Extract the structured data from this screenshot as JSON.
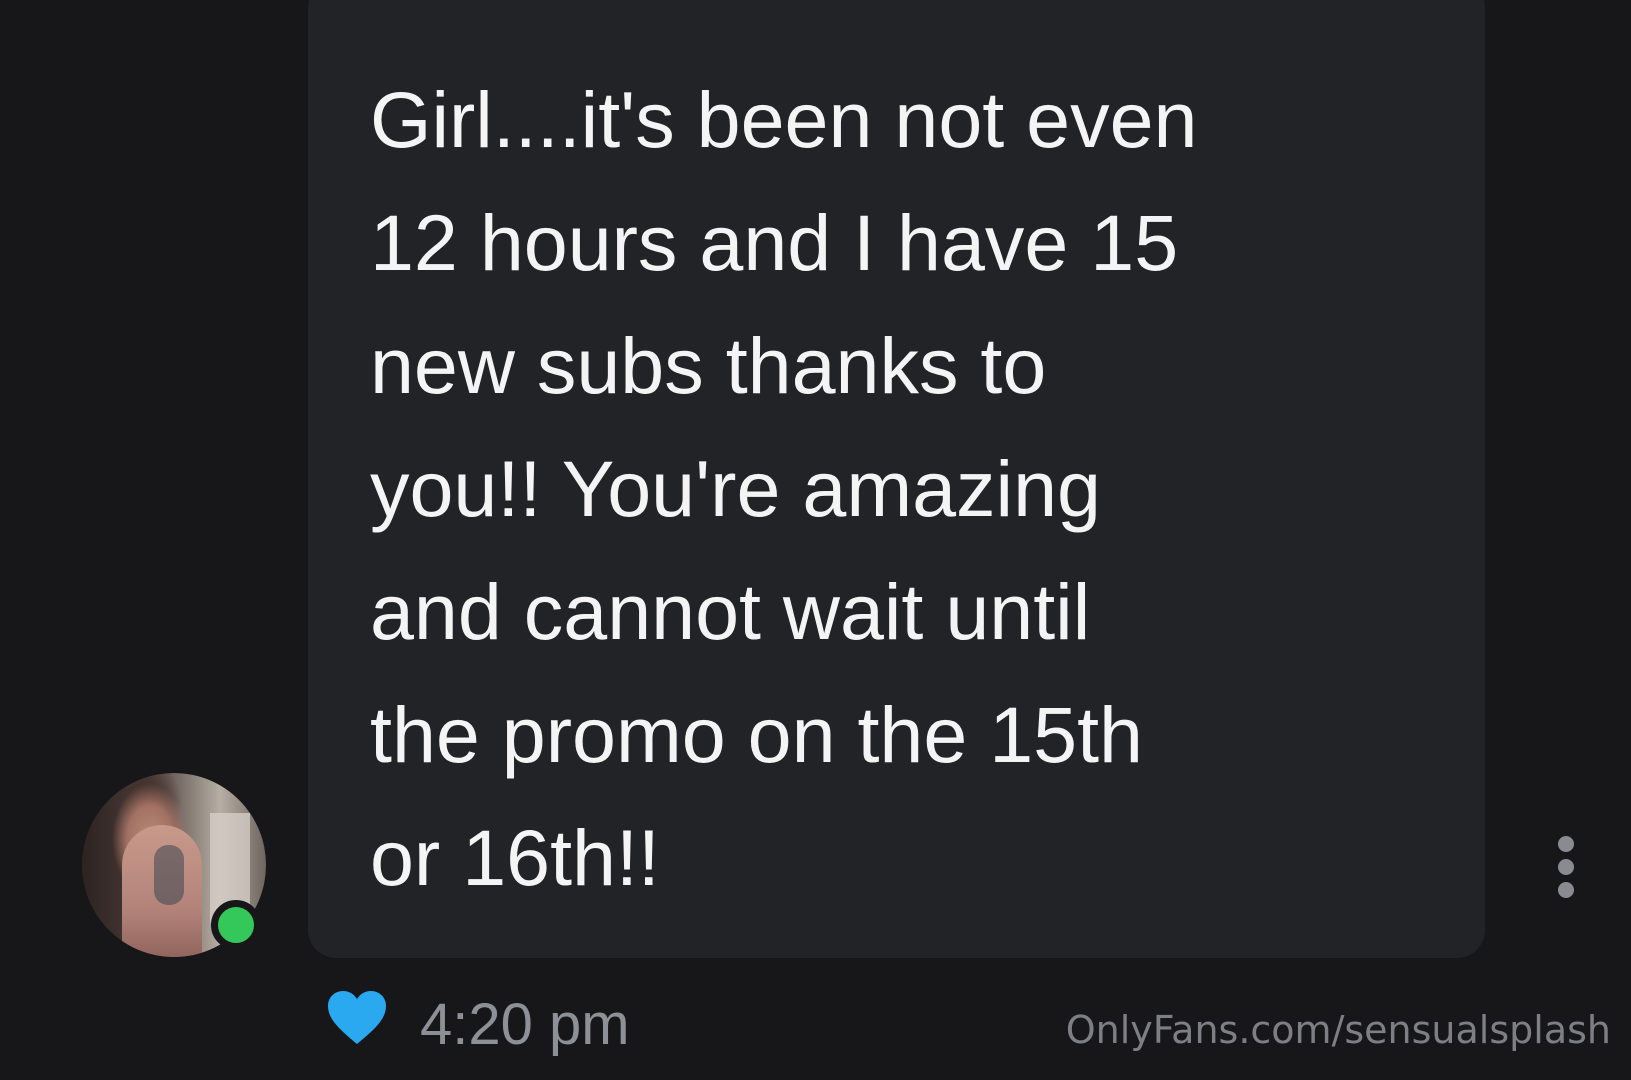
{
  "message": {
    "text": "Girl....it's been not even\n12 hours and I have 15\nnew subs thanks to\nyou!! You're amazing\nand cannot wait until\nthe promo on the 15th\nor 16th!!",
    "timestamp": "4:20 pm",
    "liked": true
  },
  "sender": {
    "online": true
  },
  "watermark": "OnlyFans.com/sensualsplash",
  "icons": {
    "like": "heart-icon",
    "more": "more-vertical-icon",
    "presence": "online-status-dot"
  },
  "colors": {
    "background": "#17171a",
    "bubble": "#222327",
    "message_text": "#f4f4f4",
    "heart": "#2aa8f0",
    "online": "#34c759",
    "meta_text": "#8d9096"
  }
}
